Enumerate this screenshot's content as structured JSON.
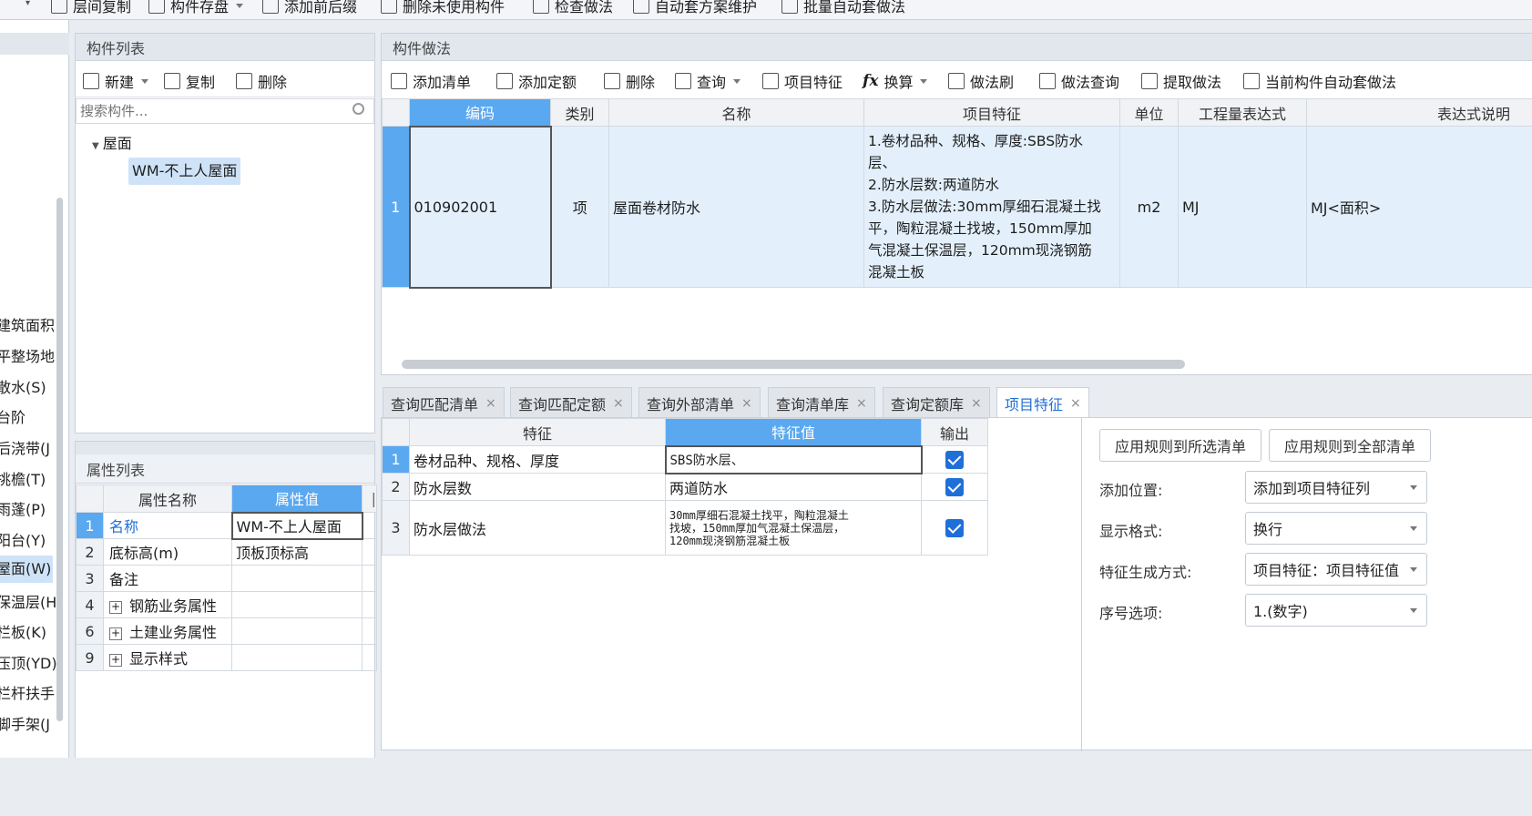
{
  "toolbar": {
    "items": [
      "层间复制",
      "构件存盘",
      "添加前后缀",
      "删除未使用构件",
      "检查做法",
      "自动套方案维护",
      "批量自动套做法"
    ]
  },
  "left_nav": {
    "items": [
      "建筑面积",
      "平整场地",
      "散水(S)",
      "台阶",
      "后浇带(J",
      "挑檐(T)",
      "雨蓬(P)",
      "阳台(Y)",
      "屋面(W)",
      "保温层(H",
      "栏板(K)",
      "压顶(YD)",
      "栏杆扶手",
      "脚手架(J"
    ],
    "selected_index": 8
  },
  "component_list": {
    "title": "构件列表",
    "new_label": "新建",
    "copy_label": "复制",
    "delete_label": "删除",
    "search_placeholder": "搜索构件...",
    "tree_root": "屋面",
    "tree_child": "WM-不上人屋面"
  },
  "property_list": {
    "title": "属性列表",
    "headers": [
      "属性名称",
      "属性值"
    ],
    "rows": [
      {
        "num": "1",
        "name": "名称",
        "value": "WM-不上人屋面"
      },
      {
        "num": "2",
        "name": "底标高(m)",
        "value": "顶板顶标高"
      },
      {
        "num": "3",
        "name": "备注",
        "value": ""
      },
      {
        "num": "4",
        "name": "钢筋业务属性",
        "value": ""
      },
      {
        "num": "6",
        "name": "土建业务属性",
        "value": ""
      },
      {
        "num": "9",
        "name": "显示样式",
        "value": ""
      }
    ]
  },
  "method": {
    "title": "构件做法",
    "toolbar": [
      "添加清单",
      "添加定额",
      "删除",
      "查询",
      "项目特征",
      "换算",
      "做法刷",
      "做法查询",
      "提取做法",
      "当前构件自动套做法"
    ],
    "headers": [
      "编码",
      "类别",
      "名称",
      "项目特征",
      "单位",
      "工程量表达式",
      "表达式说明"
    ],
    "row": {
      "num": "1",
      "code": "010902001",
      "type": "项",
      "name": "屋面卷材防水",
      "feature_lines": [
        "1.卷材品种、规格、厚度:SBS防水",
        "层、",
        "2.防水层数:两道防水",
        "3.防水层做法:30mm厚细石混凝土找",
        "平，陶粒混凝土找坡，150mm厚加",
        "气混凝土保温层，120mm现浇钢筋",
        "混凝土板"
      ],
      "unit": "m2",
      "expression": "MJ",
      "expression_desc": "MJ<面积>"
    }
  },
  "bottom_tabs": [
    "查询匹配清单",
    "查询匹配定额",
    "查询外部清单",
    "查询清单库",
    "查询定额库",
    "项目特征"
  ],
  "feature_table": {
    "headers": [
      "特征",
      "特征值",
      "输出"
    ],
    "rows": [
      {
        "num": "1",
        "feature": "卷材品种、规格、厚度",
        "value_lines": [
          "SBS防水层、"
        ],
        "output": true
      },
      {
        "num": "2",
        "feature": "防水层数",
        "value_lines": [
          "两道防水"
        ],
        "output": true
      },
      {
        "num": "3",
        "feature": "防水层做法",
        "value_lines": [
          "30mm厚细石混凝土找平，陶粒混凝土",
          "找坡，150mm厚加气混凝土保温层，",
          "120mm现浇钢筋混凝土板"
        ],
        "output": true
      }
    ]
  },
  "rule_panel": {
    "apply_selected": "应用规则到所选清单",
    "apply_all": "应用规则到全部清单",
    "fields": [
      {
        "label": "添加位置:",
        "value": "添加到项目特征列"
      },
      {
        "label": "显示格式:",
        "value": "换行"
      },
      {
        "label": "特征生成方式:",
        "value": "项目特征：项目特征值"
      },
      {
        "label": "序号选项:",
        "value": "1.(数字)"
      }
    ]
  }
}
